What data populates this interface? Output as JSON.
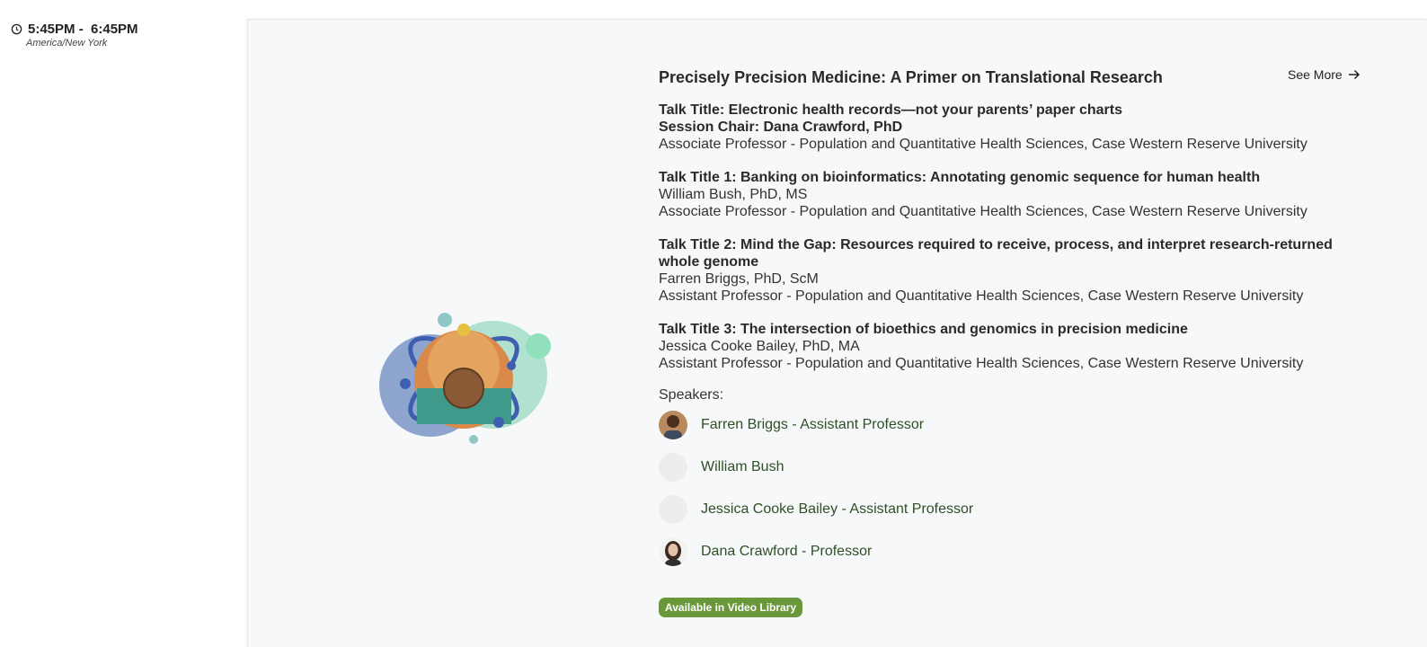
{
  "schedule": {
    "time_range": "5:45PM -  6:45PM",
    "timezone": "America/New York"
  },
  "session": {
    "title": "Precisely Precision Medicine: A Primer on Translational Research",
    "see_more": "See More",
    "talks": [
      {
        "title": "Talk Title: Electronic health records—not your parents’ paper charts",
        "chair": "Session Chair: Dana Crawford, PhD",
        "affiliation": "Associate Professor - Population and Quantitative Health Sciences, Case Western Reserve University"
      },
      {
        "title": "Talk Title 1: Banking on bioinformatics: Annotating genomic sequence for human health",
        "speaker": "William Bush, PhD, MS",
        "affiliation": "Associate Professor - Population and Quantitative Health Sciences, Case Western Reserve University"
      },
      {
        "title": "Talk Title 2: Mind the Gap: Resources required to receive, process, and interpret research-returned whole genome",
        "speaker": "Farren Briggs, PhD, ScM",
        "affiliation": "Assistant Professor - Population and Quantitative Health Sciences, Case Western Reserve University"
      },
      {
        "title": "Talk Title 3: The intersection of bioethics and genomics in precision medicine",
        "speaker": "Jessica Cooke Bailey, PhD, MA",
        "affiliation": "Assistant Professor - Population and Quantitative Health Sciences, Case Western Reserve University"
      }
    ],
    "speakers_label": "Speakers:",
    "speakers": [
      {
        "name": "Farren Briggs - Assistant Professor",
        "avatar": "photo"
      },
      {
        "name": "William Bush",
        "avatar": "placeholder"
      },
      {
        "name": "Jessica Cooke Bailey - Assistant Professor",
        "avatar": "placeholder"
      },
      {
        "name": "Dana Crawford - Professor",
        "avatar": "photo"
      }
    ],
    "badge": "Available in Video Library"
  },
  "colors": {
    "card_bg": "#f7f8fa",
    "speaker_link": "#2f4f26",
    "badge_bg": "#6a973a"
  },
  "icons": [
    "clock-icon",
    "arrow-right-icon"
  ]
}
